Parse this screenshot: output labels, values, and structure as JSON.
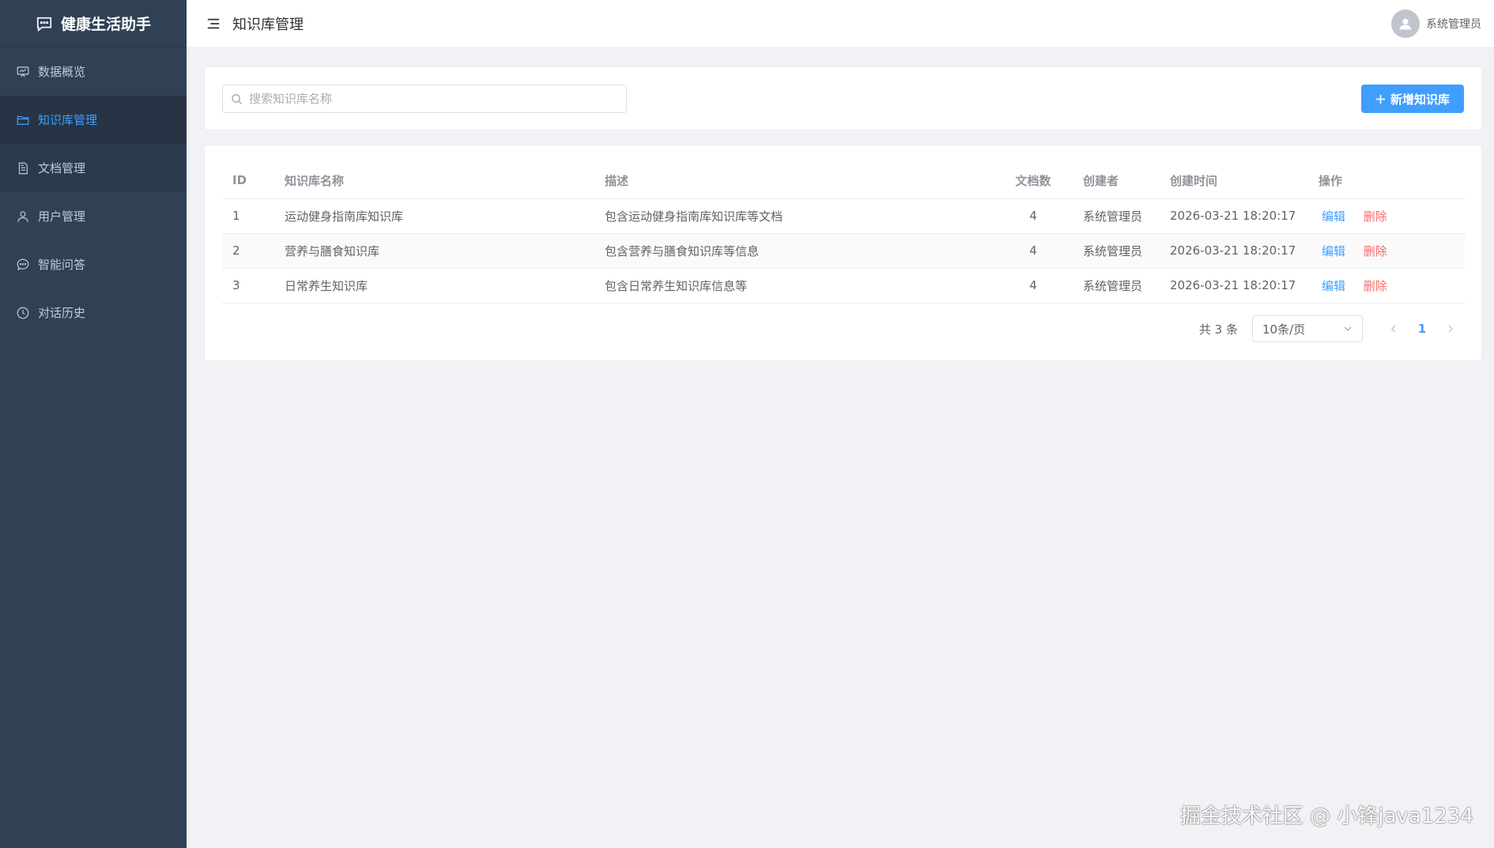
{
  "app": {
    "brand": "健康生活助手",
    "brand_icon": "chat-square-icon"
  },
  "sidebar": {
    "items": [
      {
        "label": "数据概览",
        "icon": "monitor-chart-icon",
        "active": false
      },
      {
        "label": "知识库管理",
        "icon": "folder-icon",
        "active": true
      },
      {
        "label": "文档管理",
        "icon": "document-icon",
        "active": false
      },
      {
        "label": "用户管理",
        "icon": "user-icon",
        "active": false
      },
      {
        "label": "智能问答",
        "icon": "chat-icon",
        "active": false
      },
      {
        "label": "对话历史",
        "icon": "clock-icon",
        "active": false
      }
    ]
  },
  "header": {
    "title": "知识库管理",
    "user_name": "系统管理员"
  },
  "search": {
    "placeholder": "搜索知识库名称",
    "value": ""
  },
  "toolbar": {
    "add_label": "新增知识库"
  },
  "table": {
    "columns": [
      "ID",
      "知识库名称",
      "描述",
      "文档数",
      "创建者",
      "创建时间",
      "操作"
    ],
    "rows": [
      {
        "id": "1",
        "name": "运动健身指南库知识库",
        "desc": "包含运动健身指南库知识库等文档",
        "docs": "4",
        "creator": "系统管理员",
        "created": "2026-03-21 18:20:17",
        "edit": "编辑",
        "delete": "删除"
      },
      {
        "id": "2",
        "name": "营养与膳食知识库",
        "desc": "包含营养与膳食知识库等信息",
        "docs": "4",
        "creator": "系统管理员",
        "created": "2026-03-21 18:20:17",
        "edit": "编辑",
        "delete": "删除"
      },
      {
        "id": "3",
        "name": "日常养生知识库",
        "desc": "包含日常养生知识库信息等",
        "docs": "4",
        "creator": "系统管理员",
        "created": "2026-03-21 18:20:17",
        "edit": "编辑",
        "delete": "删除"
      }
    ]
  },
  "pagination": {
    "total": "共 3 条",
    "page_size": "10条/页",
    "current_page": "1"
  },
  "watermark": "掘金技术社区 @ 小锋java1234",
  "colors": {
    "sidebar_bg": "#304156",
    "primary": "#409eff",
    "danger": "#f56c6c"
  }
}
